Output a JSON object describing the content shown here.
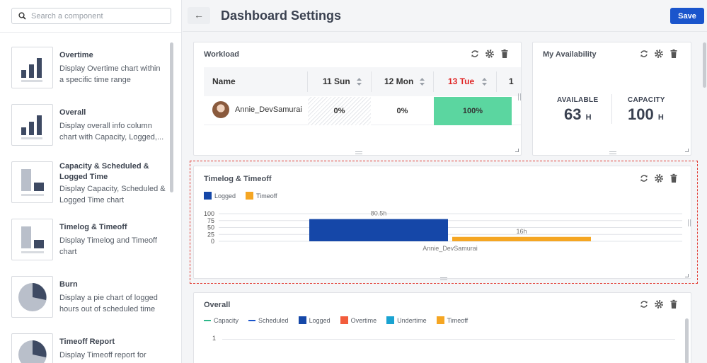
{
  "sidebar": {
    "search_placeholder": "Search a component",
    "components": [
      {
        "title": "Overtime",
        "desc": "Display Overtime chart within a specific time range"
      },
      {
        "title": "Overall",
        "desc": "Display overall info column chart with Capacity, Logged,..."
      },
      {
        "title": "Capacity & Scheduled & Logged Time",
        "desc": "Display Capacity, Scheduled & Logged Time chart"
      },
      {
        "title": "Timelog & Timeoff",
        "desc": "Display Timelog and Timeoff chart"
      },
      {
        "title": "Burn",
        "desc": "Display a pie chart of logged hours out of scheduled time"
      },
      {
        "title": "Timeoff Report",
        "desc": "Display Timeoff report for"
      }
    ]
  },
  "header": {
    "title": "Dashboard Settings",
    "save_label": "Save",
    "back_icon": "arrow-left-icon"
  },
  "workload": {
    "title": "Workload",
    "columns": [
      "Name",
      "11 Sun",
      "12 Mon",
      "13 Tue",
      "1"
    ],
    "highlight_column_color": "#e02424",
    "row": {
      "user": "Annie_DevSamurai",
      "values": [
        "0%",
        "0%",
        "100%"
      ]
    },
    "full_color": "#5bd6a0"
  },
  "availability": {
    "title": "My Availability",
    "available_label": "AVAILABLE",
    "available_value": "63",
    "available_unit": "H",
    "capacity_label": "CAPACITY",
    "capacity_value": "100",
    "capacity_unit": "H"
  },
  "timelog": {
    "title": "Timelog & Timeoff"
  },
  "overall": {
    "title": "Overall",
    "legend": [
      {
        "name": "Capacity",
        "kind": "line",
        "color": "#2eb88a"
      },
      {
        "name": "Scheduled",
        "kind": "line",
        "color": "#1a55cc"
      },
      {
        "name": "Logged",
        "kind": "box",
        "color": "#1547a8"
      },
      {
        "name": "Overtime",
        "kind": "box",
        "color": "#f25c3c"
      },
      {
        "name": "Undertime",
        "kind": "box",
        "color": "#1aa3d1"
      },
      {
        "name": "Timeoff",
        "kind": "box",
        "color": "#f5a623"
      }
    ],
    "y_tick": "1"
  },
  "chart_data": {
    "type": "bar",
    "title": "Timelog & Timeoff",
    "categories": [
      "Annie_DevSamurai"
    ],
    "series": [
      {
        "name": "Logged",
        "values": [
          80.5
        ],
        "label": "80.5h",
        "color": "#1547a8"
      },
      {
        "name": "Timeoff",
        "values": [
          16
        ],
        "label": "16h",
        "color": "#f5a623"
      }
    ],
    "yticks": [
      "100",
      "75",
      "50",
      "25",
      "0"
    ],
    "ylim": [
      0,
      100
    ],
    "legend_position": "top-left",
    "grid": true
  }
}
